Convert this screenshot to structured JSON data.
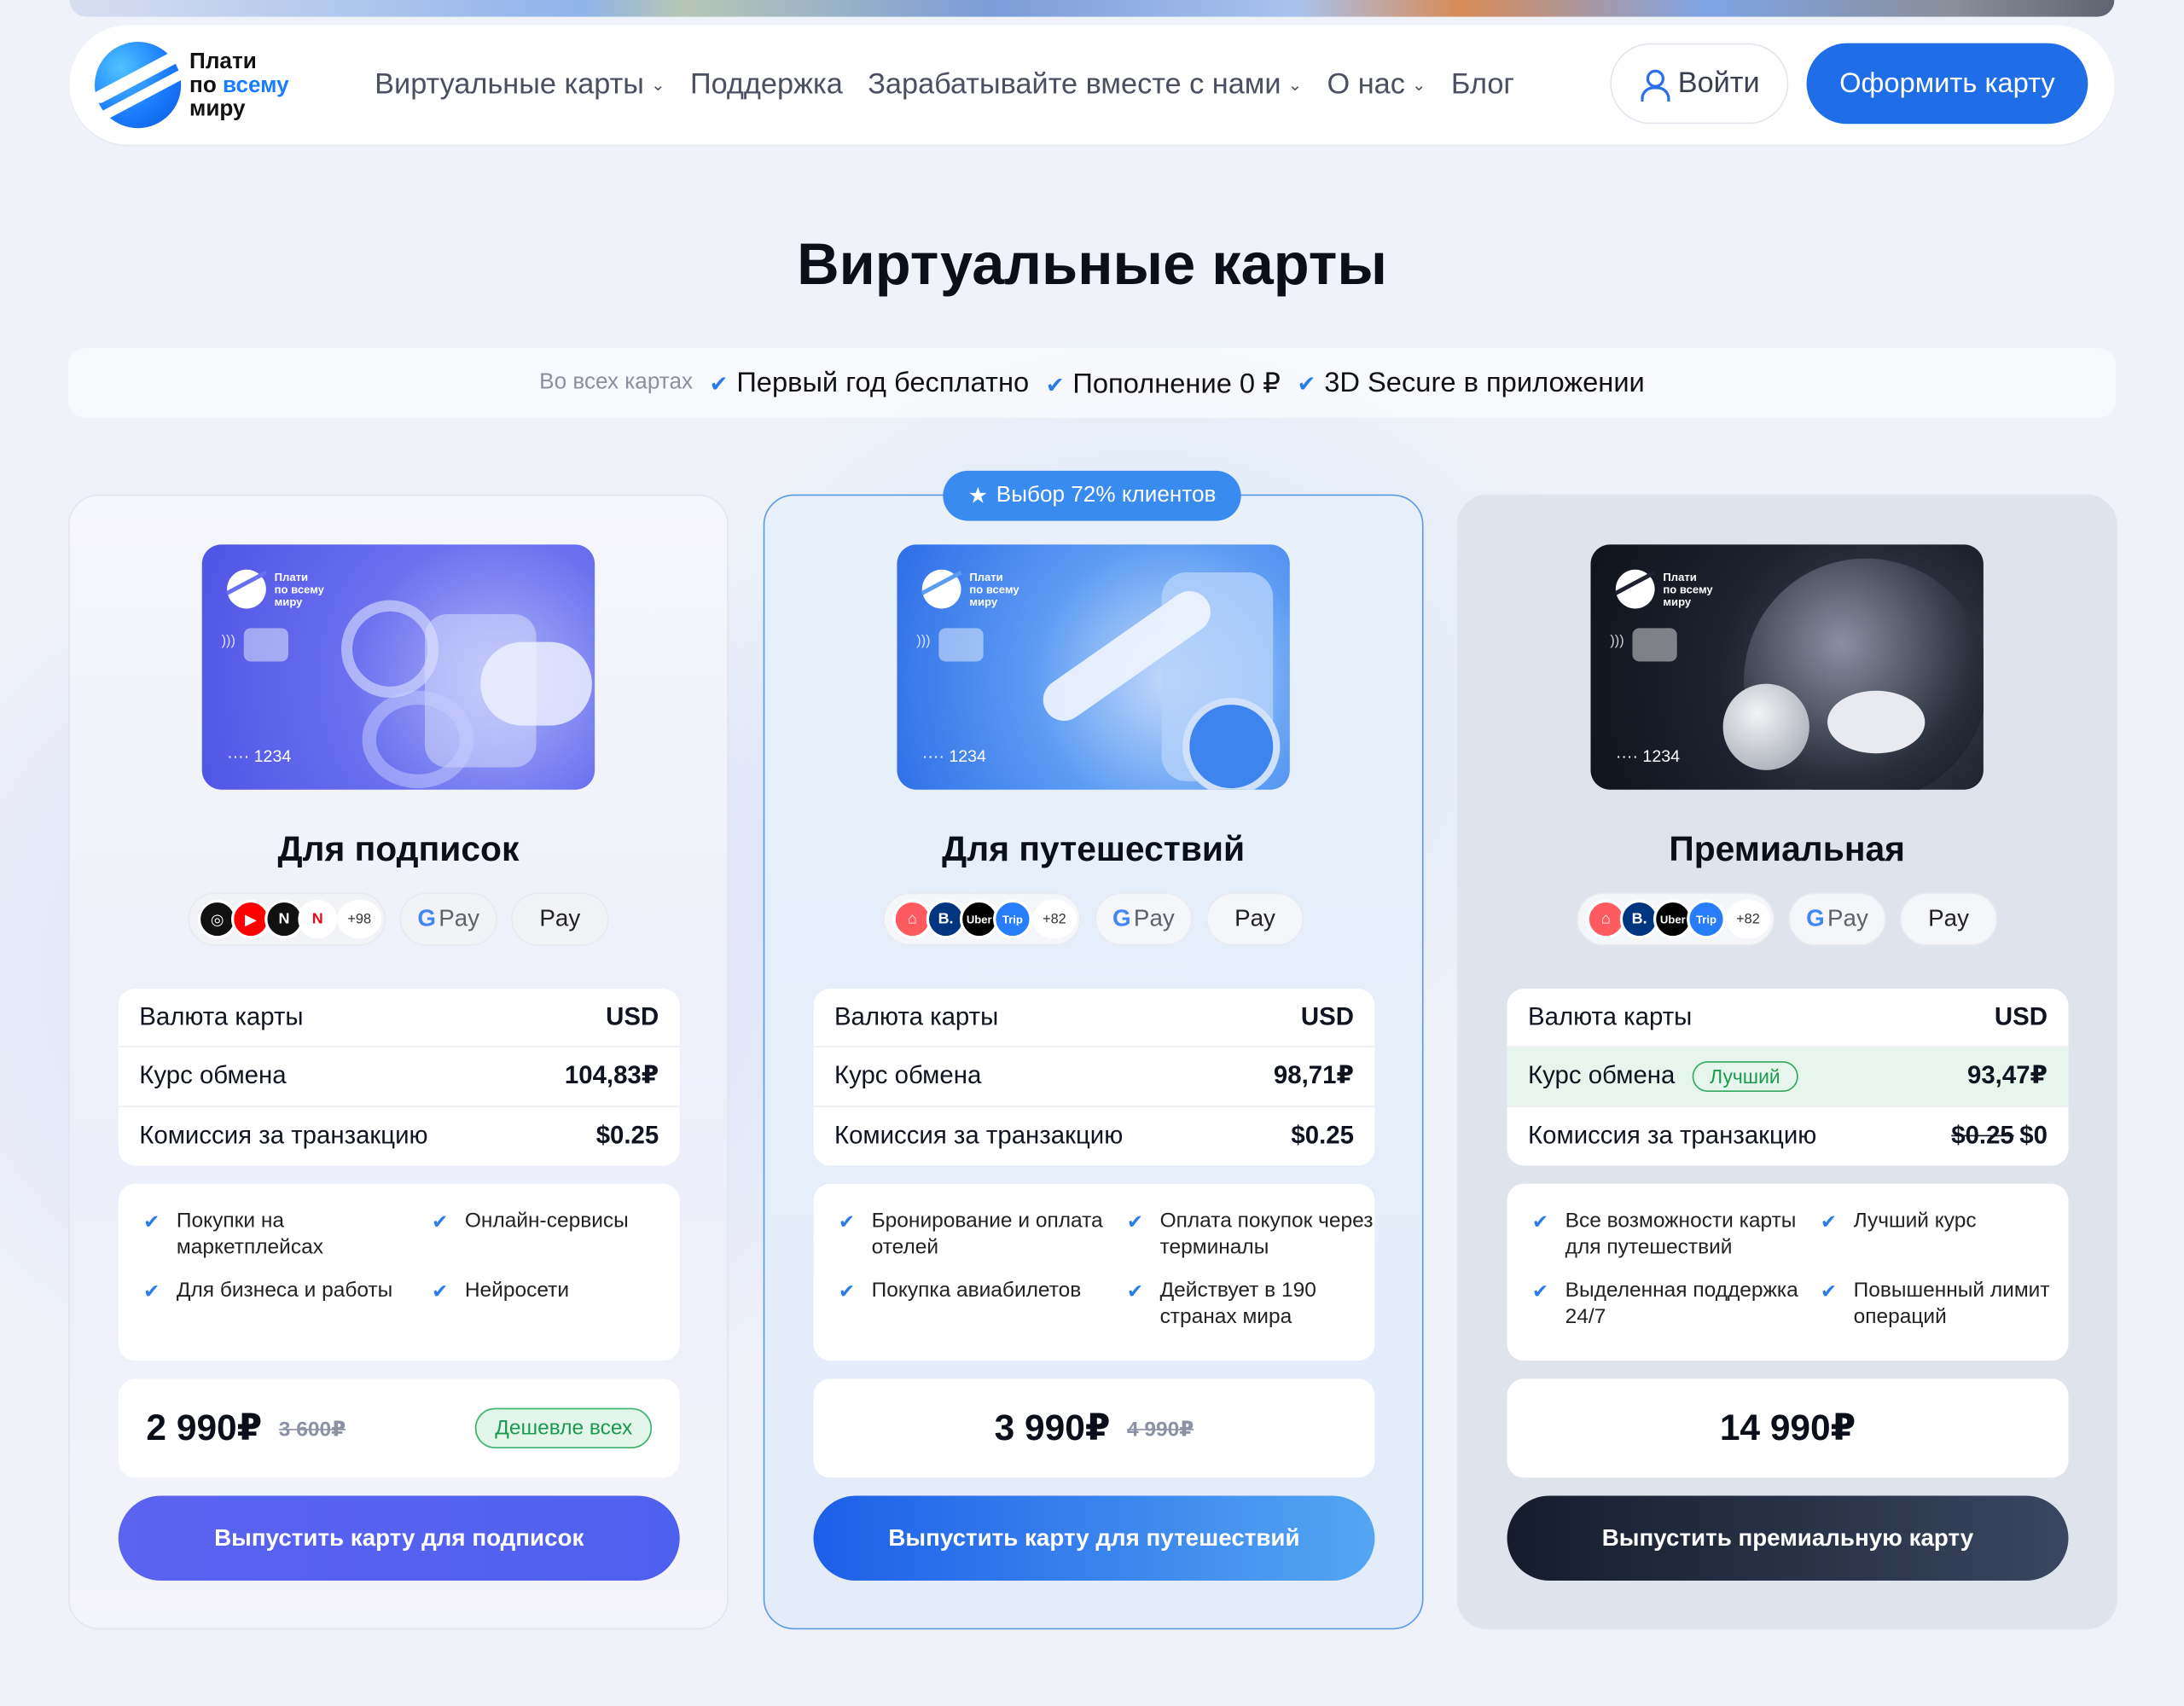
{
  "header": {
    "logo_lines": [
      "Плати",
      "по",
      "всему",
      "миру"
    ],
    "nav": [
      {
        "label": "Виртуальные карты",
        "has_dropdown": true
      },
      {
        "label": "Поддержка",
        "has_dropdown": false
      },
      {
        "label": "Зарабатывайте вместе с нами",
        "has_dropdown": true
      },
      {
        "label": "О нас",
        "has_dropdown": true
      },
      {
        "label": "Блог",
        "has_dropdown": false
      }
    ],
    "login_label": "Войти",
    "cta_label": "Оформить карту"
  },
  "page_title": "Виртуальные карты",
  "features": {
    "prefix": "Во всех картах",
    "items": [
      "Первый год бесплатно",
      "Пополнение 0 ₽",
      "3D Secure в приложении"
    ]
  },
  "popular_badge": "Выбор 72% клиентов",
  "cards": [
    {
      "title": "Для подписок",
      "card_number": "···· 1234",
      "card_logo_text": [
        "Плати",
        "по всему",
        "миру"
      ],
      "services": [
        {
          "icon": "openai-icon",
          "color": "#111111",
          "glyph": "◎"
        },
        {
          "icon": "youtube-icon",
          "color": "#ff0000",
          "glyph": "▶"
        },
        {
          "icon": "notion-icon",
          "color": "#111111",
          "glyph": "N"
        },
        {
          "icon": "netflix-icon",
          "color": "#e50914",
          "glyph": "N"
        }
      ],
      "services_more": "+98",
      "gpay": "Pay",
      "apay": "Pay",
      "currency_label": "Валюта карты",
      "currency_value": "USD",
      "rate_label": "Курс обмена",
      "rate_value": "104,83₽",
      "fee_label": "Комиссия за транзакцию",
      "fee_value": "$0.25",
      "benefits": [
        "Покупки на маркетплейсах",
        "Онлайн-сервисы",
        "Для бизнеса и работы",
        "Нейросети"
      ],
      "price": "2 990₽",
      "old_price": "3 600₽",
      "price_badge": "Дешевле всех",
      "button": "Выпустить карту для подписок"
    },
    {
      "title": "Для путешествий",
      "card_number": "···· 1234",
      "card_logo_text": [
        "Плати",
        "по всему",
        "миру"
      ],
      "services": [
        {
          "icon": "airbnb-icon",
          "color": "#ff5a5f",
          "glyph": "⌂"
        },
        {
          "icon": "booking-icon",
          "color": "#003580",
          "glyph": "B."
        },
        {
          "icon": "uber-icon",
          "color": "#000000",
          "glyph": "Uber"
        },
        {
          "icon": "trip-icon",
          "color": "#287dfa",
          "glyph": "Trip"
        }
      ],
      "services_more": "+82",
      "gpay": "Pay",
      "apay": "Pay",
      "currency_label": "Валюта карты",
      "currency_value": "USD",
      "rate_label": "Курс обмена",
      "rate_value": "98,71₽",
      "fee_label": "Комиссия за транзакцию",
      "fee_value": "$0.25",
      "benefits": [
        "Бронирование и оплата отелей",
        "Оплата покупок через терминалы",
        "Покупка авиабилетов",
        "Действует в 190 странах мира"
      ],
      "price": "3 990₽",
      "old_price": "4 990₽",
      "button": "Выпустить карту для путешествий"
    },
    {
      "title": "Премиальная",
      "card_number": "···· 1234",
      "card_logo_text": [
        "Плати",
        "по всему",
        "миру"
      ],
      "services": [
        {
          "icon": "airbnb-icon",
          "color": "#ff5a5f",
          "glyph": "⌂"
        },
        {
          "icon": "booking-icon",
          "color": "#003580",
          "glyph": "B."
        },
        {
          "icon": "uber-icon",
          "color": "#000000",
          "glyph": "Uber"
        },
        {
          "icon": "trip-icon",
          "color": "#287dfa",
          "glyph": "Trip"
        }
      ],
      "services_more": "+82",
      "gpay": "Pay",
      "apay": "Pay",
      "currency_label": "Валюта карты",
      "currency_value": "USD",
      "rate_label": "Курс обмена",
      "rate_badge": "Лучший",
      "rate_value": "93,47₽",
      "fee_label": "Комиссия за транзакцию",
      "fee_old": "$0.25",
      "fee_value": "$0",
      "benefits": [
        "Все возможности карты для путешествий",
        "Лучший курс",
        "Выделенная поддержка 24/7",
        "Повышенный лимит операций"
      ],
      "price": "14 990₽",
      "button": "Выпустить премиальную карту"
    }
  ],
  "colors": {
    "accent": "#1f6ee8",
    "check": "#2a7de8",
    "best_green": "#1e9a4e",
    "popular_border": "#5a9ae8"
  }
}
